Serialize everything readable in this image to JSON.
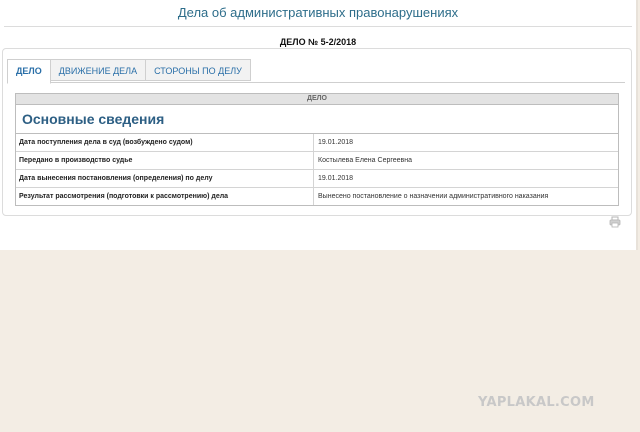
{
  "header": {
    "title": "Дела об административных правонарушениях",
    "case_number": "ДЕЛО № 5-2/2018"
  },
  "tabs": [
    {
      "label": "ДЕЛО",
      "active": true
    },
    {
      "label": "ДВИЖЕНИЕ ДЕЛА",
      "active": false
    },
    {
      "label": "СТОРОНЫ ПО ДЕЛУ",
      "active": false
    }
  ],
  "table": {
    "header": "ДЕЛО",
    "section_title": "Основные сведения",
    "rows": [
      {
        "label": "Дата поступления дела в суд (возбуждено судом)",
        "value": "19.01.2018"
      },
      {
        "label": "Передано в производство судье",
        "value": "Костылева Елена Сергеевна"
      },
      {
        "label": "Дата вынесения постановления (определения) по делу",
        "value": "19.01.2018"
      },
      {
        "label": "Результат рассмотрения (подготовки к рассмотрению) дела",
        "value": "Вынесено постановление о назначении административного наказания"
      }
    ]
  },
  "icons": {
    "print": "printer-icon"
  },
  "watermark": "YAPLAKAL.COM"
}
